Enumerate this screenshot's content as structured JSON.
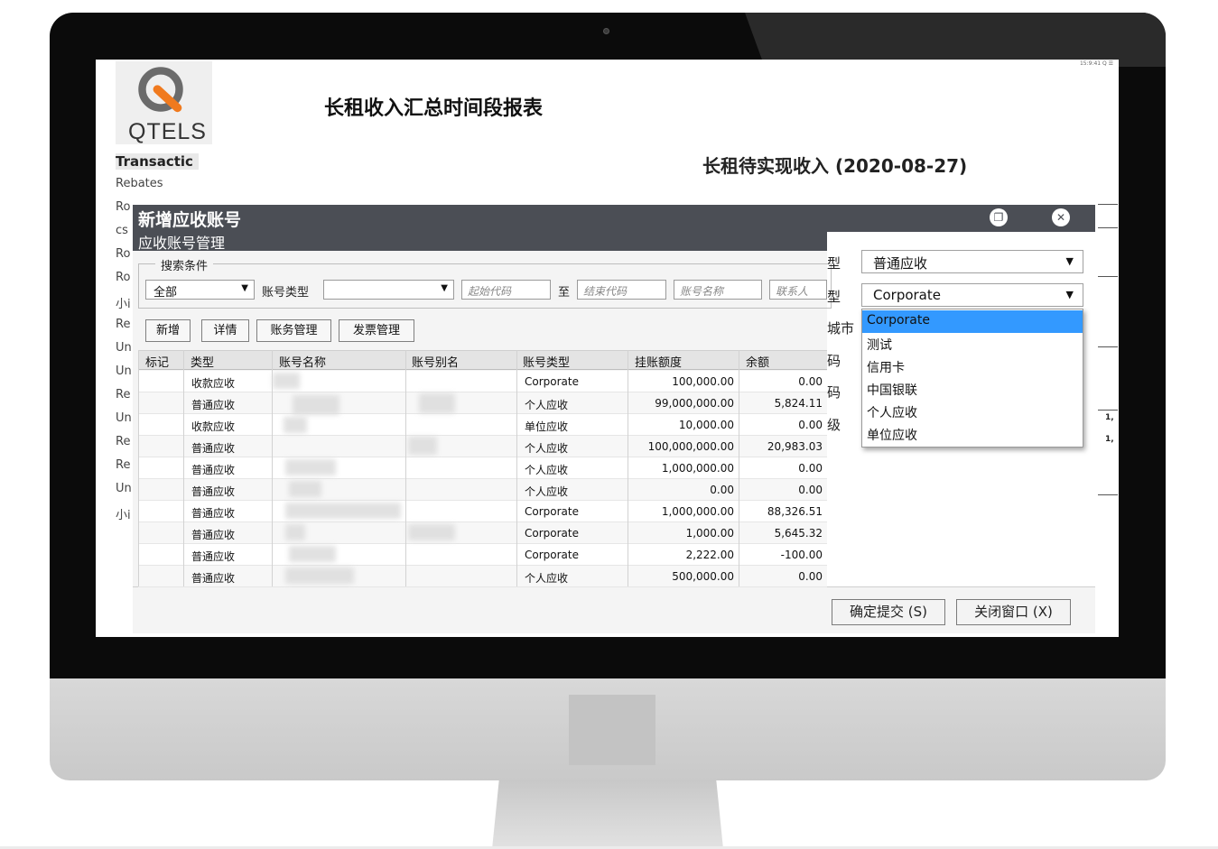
{
  "screen": {
    "status_text": "15:9:41 Q ☰",
    "logo_text": "QTELS",
    "report_title": "长租收入汇总时间段报表",
    "report_subtitle": "长租待实现收入 (2020-08-27)",
    "sidebar": [
      {
        "label": "Transactic",
        "active": true
      },
      {
        "label": "Rebates"
      },
      {
        "label": "Ro"
      },
      {
        "label": "cs"
      },
      {
        "label": "Ro"
      },
      {
        "label": "Ro"
      },
      {
        "label": "小i"
      },
      {
        "label": "Re"
      },
      {
        "label": "Un"
      },
      {
        "label": "Un"
      },
      {
        "label": "Re"
      },
      {
        "label": "Un"
      },
      {
        "label": "Re"
      },
      {
        "label": "Re"
      },
      {
        "label": "Un"
      },
      {
        "label": "小i"
      }
    ],
    "right_values": [
      "1,",
      "1,"
    ]
  },
  "dialog": {
    "title": "新增应收账号",
    "subtitle": "应收账号管理",
    "title_buttons": {
      "restore_icon": "restore-icon",
      "close_icon": "close-icon"
    },
    "search": {
      "legend": "搜索条件",
      "scope_value": "全部",
      "account_type_label": "账号类型",
      "account_type_value": "",
      "start_code_placeholder": "起始代码",
      "to_label": "至",
      "end_code_placeholder": "结束代码",
      "account_name_placeholder": "账号名称",
      "contact_placeholder": "联系人"
    },
    "toolbar": {
      "add_label": "新增",
      "details_label": "详情",
      "finance_label": "账务管理",
      "invoice_label": "发票管理"
    },
    "grid": {
      "columns": [
        "标记",
        "类型",
        "账号名称",
        "账号别名",
        "账号类型",
        "挂账额度",
        "余额"
      ],
      "rows": [
        {
          "type": "收款应收",
          "account_type": "Corporate",
          "credit": "100,000.00",
          "balance": "0.00"
        },
        {
          "type": "普通应收",
          "account_type": "个人应收",
          "credit": "99,000,000.00",
          "balance": "5,824.11"
        },
        {
          "type": "收款应收",
          "account_type": "单位应收",
          "credit": "10,000.00",
          "balance": "0.00"
        },
        {
          "type": "普通应收",
          "account_type": "个人应收",
          "credit": "100,000,000.00",
          "balance": "20,983.03"
        },
        {
          "type": "普通应收",
          "account_type": "个人应收",
          "credit": "1,000,000.00",
          "balance": "0.00"
        },
        {
          "type": "普通应收",
          "account_type": "个人应收",
          "credit": "0.00",
          "balance": "0.00"
        },
        {
          "type": "普通应收",
          "account_type": "Corporate",
          "credit": "1,000,000.00",
          "balance": "88,326.51"
        },
        {
          "type": "普通应收",
          "account_type": "Corporate",
          "credit": "1,000.00",
          "balance": "5,645.32"
        },
        {
          "type": "普通应收",
          "account_type": "Corporate",
          "credit": "2,222.00",
          "balance": "-100.00"
        },
        {
          "type": "普通应收",
          "account_type": "个人应收",
          "credit": "500,000.00",
          "balance": "0.00"
        }
      ]
    },
    "form": {
      "labels": [
        "型",
        "型",
        "城市",
        "码",
        "码",
        "级"
      ],
      "receivable_type_value": "普通应收",
      "account_type_value": "Corporate",
      "account_type_options": [
        "Corporate",
        "测试",
        "信用卡",
        "中国银联",
        "个人应收",
        "单位应收"
      ],
      "selected_option": "Corporate"
    },
    "footer": {
      "submit_label": "确定提交 (S)",
      "close_label": "关闭窗口 (X)"
    }
  },
  "colors": {
    "titlebar": "#4b4e55",
    "selection": "#3399ff",
    "logo_orange": "#f07a1e",
    "logo_gray": "#6b6b6b"
  }
}
